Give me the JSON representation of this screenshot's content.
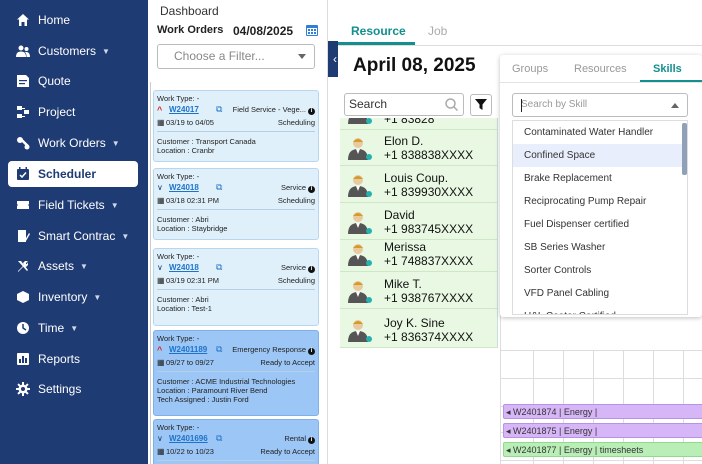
{
  "sidebar": {
    "items": [
      {
        "label": "Home",
        "icon": "home-icon",
        "caret": false
      },
      {
        "label": "Customers",
        "icon": "users-icon",
        "caret": true
      },
      {
        "label": "Quote",
        "icon": "quote-icon",
        "caret": false
      },
      {
        "label": "Project",
        "icon": "project-icon",
        "caret": false
      },
      {
        "label": "Work Orders",
        "icon": "work-orders-icon",
        "caret": true
      },
      {
        "label": "Scheduler",
        "icon": "scheduler-icon",
        "caret": false,
        "active": true
      },
      {
        "label": "Field Tickets",
        "icon": "ticket-icon",
        "caret": true
      },
      {
        "label": "Smart Contrac",
        "icon": "contract-icon",
        "caret": true
      },
      {
        "label": "Assets",
        "icon": "tools-icon",
        "caret": true
      },
      {
        "label": "Inventory",
        "icon": "box-icon",
        "caret": true
      },
      {
        "label": "Time",
        "icon": "clock-icon",
        "caret": true
      },
      {
        "label": "Reports",
        "icon": "reports-icon",
        "caret": false
      },
      {
        "label": "Settings",
        "icon": "gear-icon",
        "caret": false
      }
    ]
  },
  "breadcrumb": "Dashboard",
  "work_orders": {
    "title": "Work Orders",
    "date": "04/08/2025",
    "filter_placeholder": "Choose a Filter...",
    "cards": [
      {
        "type_label": "Work Type: -",
        "id": "W24017",
        "service": "Field Service - Vege...",
        "dates": "03/19 to 04/05",
        "status": "Scheduling",
        "customer": "Customer : Transport Canada",
        "location": "Location : Cranbr",
        "tech": ""
      },
      {
        "type_label": "Work Type: -",
        "id": "W24018",
        "service": "Service",
        "dates": "03/18 02:31 PM",
        "status": "Scheduling",
        "customer": "Customer : Abri",
        "location": "Location : Staybridge",
        "tech": ""
      },
      {
        "type_label": "Work Type: -",
        "id": "W24018",
        "service": "Service",
        "dates": "03/19 02:31 PM",
        "status": "Scheduling",
        "customer": "Customer : Abri",
        "location": "Location : Test-1",
        "tech": ""
      },
      {
        "type_label": "Work Type: -",
        "id": "W2401189",
        "service": "Emergency Response",
        "dates": "09/27 to 09/27",
        "status": "Ready to Accept",
        "customer": "Customer : ACME Industrial Technologies",
        "location": "Location : Paramount River Bend",
        "tech": "Tech Assigned : Justin Ford"
      },
      {
        "type_label": "Work Type: -",
        "id": "W2401696",
        "service": "Rental",
        "dates": "10/22 to 10/23",
        "status": "Ready to Accept",
        "customer": "",
        "location": "",
        "tech": ""
      }
    ]
  },
  "main": {
    "tabs": [
      "Resource",
      "Job"
    ],
    "date_heading": "April 08, 2025",
    "search_placeholder": "Search",
    "resources": [
      {
        "name": "",
        "phone": "+1 83828"
      },
      {
        "name": "Elon D.",
        "phone": "+1 838838XXXX"
      },
      {
        "name": "Louis Coup.",
        "phone": "+1 839930XXXX"
      },
      {
        "name": "David",
        "phone": "+1 983745XXXX"
      },
      {
        "name": "Merissa",
        "phone": "+1 748837XXXX"
      },
      {
        "name": "Mike T.",
        "phone": "+1 938767XXXX"
      },
      {
        "name": "Joy K. Sine",
        "phone": "+1 836374XXXX"
      }
    ],
    "bars": [
      {
        "text": "◂ W2401874 | Energy |",
        "color": "purple"
      },
      {
        "text": "◂ W2401875 | Energy |",
        "color": "purple"
      },
      {
        "text": "◂ W2401877 | Energy | timesheets",
        "color": "green"
      }
    ]
  },
  "popover": {
    "tabs": [
      "Groups",
      "Resources",
      "Skills"
    ],
    "active_tab": "Skills",
    "input_placeholder": "Search by Skill",
    "skills": [
      "Contaminated Water Handler",
      "Confined Space",
      "Brake Replacement",
      "Reciprocating Pump Repair",
      "Fuel Dispenser certified",
      "SB Series Washer",
      "Sorter Controls",
      "VFD Panel Cabling",
      "H&L Coater Certified"
    ],
    "highlighted_index": 1
  },
  "colors": {
    "sidebar": "#1f3b73",
    "accent": "#138f8f",
    "resource_bg": "#e9f8e3",
    "card_bg": "#dff0fb",
    "card_dark": "#9cc6f5"
  }
}
